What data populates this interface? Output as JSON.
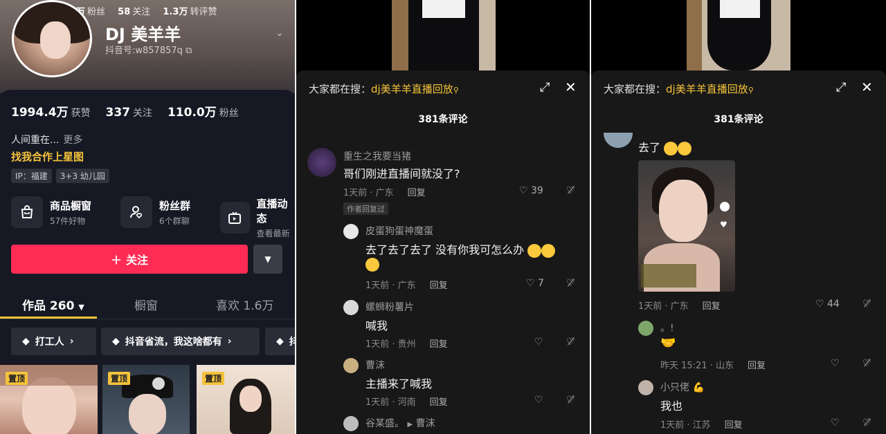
{
  "profile": {
    "top_stats": [
      {
        "value": "万",
        "label": "粉丝"
      },
      {
        "value": "58",
        "label": "关注"
      },
      {
        "value": "1.3万",
        "label": "转评赞"
      }
    ],
    "name": "DJ 美羊羊",
    "douyin_id": "抖音号:w857857q",
    "counts": [
      {
        "value": "1994.4万",
        "label": "获赞"
      },
      {
        "value": "337",
        "label": "关注"
      },
      {
        "value": "110.0万",
        "label": "粉丝"
      }
    ],
    "bio": "人间重在...",
    "bio_more": "更多",
    "collab": "找我合作上星图",
    "tags": [
      "IP：福建",
      "3+3 幼儿园"
    ],
    "services": [
      {
        "title": "商品橱窗",
        "sub": "57件好物",
        "icon": "shopping-bag-icon"
      },
      {
        "title": "粉丝群",
        "sub": "6个群聊",
        "icon": "fan-group-icon"
      },
      {
        "title": "直播动态",
        "sub": "查看最新",
        "icon": "live-tv-icon"
      }
    ],
    "follow_label": "关注",
    "tabs": [
      "作品 260",
      "橱窗",
      "喜欢 1.6万"
    ],
    "collections": [
      "打工人",
      "抖音省流，我这啥都有",
      "抖"
    ],
    "pin_label": "置顶"
  },
  "comments_a": {
    "search_prefix": "大家都在搜：",
    "search_term": "dj美羊羊直播回放",
    "count": "381条评论",
    "items": [
      {
        "name": "重生之我要当猪",
        "text": "哥们刚进直播间就没了?",
        "meta": "1天前 · 广东",
        "reply": "回复",
        "likes": "39",
        "badge": "作者回复过"
      },
      {
        "name": "皮蛋狗蛋神魔蛋",
        "text": "去了去了去了 没有你我可怎么办",
        "meta": "1天前 · 广东",
        "reply": "回复",
        "likes": "7"
      },
      {
        "name": "螺蛳粉薯片",
        "text": "喊我",
        "meta": "1天前 · 贵州",
        "reply": "回复",
        "likes": ""
      },
      {
        "name": "曹沫",
        "text": "主播来了喊我",
        "meta": "1天前 · 河南",
        "reply": "回复",
        "likes": ""
      },
      {
        "name": "谷某盛。",
        "reply_to": "曹沫",
        "text": "",
        "meta": "",
        "reply": "",
        "likes": ""
      }
    ]
  },
  "comments_b": {
    "search_prefix": "大家都在搜：",
    "search_term": "dj美羊羊直播回放",
    "count": "381条评论",
    "items": [
      {
        "name": "",
        "text": "去了",
        "meta": "1天前 · 广东",
        "reply": "回复",
        "likes": "44"
      },
      {
        "name": "。!",
        "text": "",
        "meta": "昨天 15:21 · 山东",
        "reply": "回复",
        "likes": ""
      },
      {
        "name": "小只佬",
        "text": "我也",
        "meta": "1天前 · 江苏",
        "reply": "回复",
        "likes": ""
      }
    ]
  },
  "colors": {
    "accent": "#fe2c55",
    "gold": "#f5c33b",
    "bg": "#161823"
  }
}
